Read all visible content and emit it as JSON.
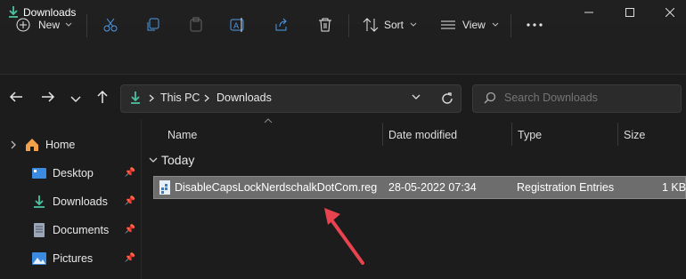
{
  "window": {
    "title": "Downloads"
  },
  "toolbar": {
    "new_label": "New",
    "sort_label": "Sort",
    "view_label": "View"
  },
  "breadcrumb": {
    "root": "This PC",
    "current": "Downloads"
  },
  "search": {
    "placeholder": "Search Downloads"
  },
  "nav": {
    "items": [
      {
        "label": "Home",
        "icon": "home-icon"
      },
      {
        "label": "Desktop",
        "icon": "desktop-icon"
      },
      {
        "label": "Downloads",
        "icon": "download-icon"
      },
      {
        "label": "Documents",
        "icon": "documents-icon"
      },
      {
        "label": "Pictures",
        "icon": "pictures-icon"
      }
    ]
  },
  "columns": {
    "name": "Name",
    "date": "Date modified",
    "type": "Type",
    "size": "Size"
  },
  "group": {
    "label": "Today"
  },
  "files": [
    {
      "name": "DisableCapsLockNerdschalkDotCom.reg",
      "date": "28-05-2022 07:34",
      "type": "Registration Entries",
      "size": "1 KB"
    }
  ],
  "colors": {
    "accent": "#4cc2a0",
    "selection": "#6d6d6d",
    "arrow": "#e8434f"
  }
}
